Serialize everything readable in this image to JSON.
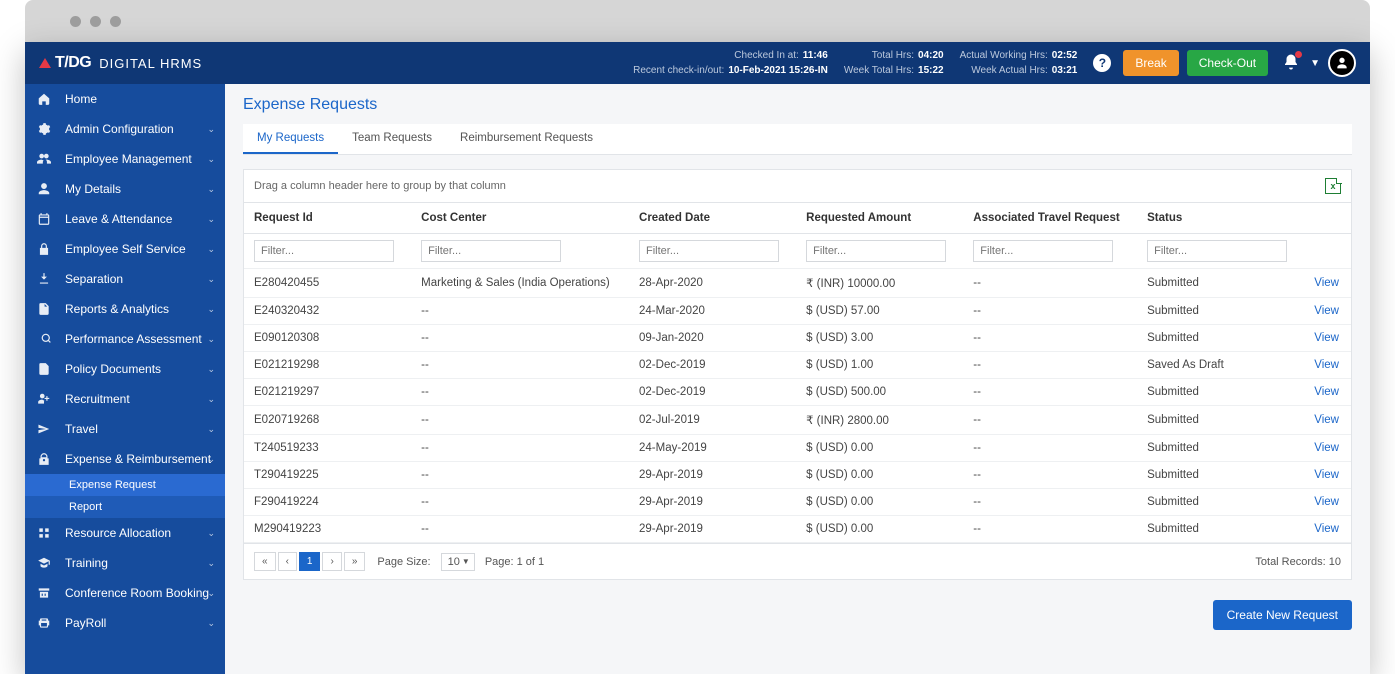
{
  "brand": {
    "tdg": "T/DG",
    "name": "DIGITAL HRMS"
  },
  "header": {
    "checked_in_label": "Checked In at:",
    "checked_in_value": "11:46",
    "recent_label": "Recent check-in/out:",
    "recent_value": "10-Feb-2021 15:26-IN",
    "total_hrs_label": "Total Hrs:",
    "total_hrs_value": "04:20",
    "week_total_label": "Week Total Hrs:",
    "week_total_value": "15:22",
    "actual_label": "Actual Working Hrs:",
    "actual_value": "02:52",
    "week_actual_label": "Week Actual Hrs:",
    "week_actual_value": "03:21",
    "break_btn": "Break",
    "checkout_btn": "Check-Out"
  },
  "sidebar": {
    "items": [
      {
        "label": "Home",
        "expandable": false
      },
      {
        "label": "Admin Configuration",
        "expandable": true
      },
      {
        "label": "Employee Management",
        "expandable": true
      },
      {
        "label": "My Details",
        "expandable": true
      },
      {
        "label": "Leave & Attendance",
        "expandable": true
      },
      {
        "label": "Employee Self Service",
        "expandable": true
      },
      {
        "label": "Separation",
        "expandable": true
      },
      {
        "label": "Reports & Analytics",
        "expandable": true
      },
      {
        "label": "Performance Assessment",
        "expandable": true
      },
      {
        "label": "Policy Documents",
        "expandable": true
      },
      {
        "label": "Recruitment",
        "expandable": true
      },
      {
        "label": "Travel",
        "expandable": true
      },
      {
        "label": "Expense & Reimbursement",
        "expandable": true
      },
      {
        "label": "Resource Allocation",
        "expandable": true
      },
      {
        "label": "Training",
        "expandable": true
      },
      {
        "label": "Conference Room Booking",
        "expandable": true
      },
      {
        "label": "PayRoll",
        "expandable": true
      }
    ],
    "sub_expense": [
      {
        "label": "Expense Request",
        "active": true
      },
      {
        "label": "Report",
        "active": false
      }
    ]
  },
  "page": {
    "title": "Expense Requests",
    "tabs": [
      "My Requests",
      "Team Requests",
      "Reimbursement Requests"
    ],
    "active_tab": 0,
    "group_hint": "Drag a column header here to group by that column",
    "columns": [
      "Request Id",
      "Cost Center",
      "Created Date",
      "Requested Amount",
      "Associated Travel Request",
      "Status",
      ""
    ],
    "filter_placeholder": "Filter...",
    "rows": [
      {
        "id": "E280420455",
        "cc": "Marketing & Sales (India Operations)",
        "date": "28-Apr-2020",
        "amt": "₹ (INR) 10000.00",
        "atr": "--",
        "status": "Submitted"
      },
      {
        "id": "E240320432",
        "cc": "--",
        "date": "24-Mar-2020",
        "amt": "$ (USD) 57.00",
        "atr": "--",
        "status": "Submitted"
      },
      {
        "id": "E090120308",
        "cc": "--",
        "date": "09-Jan-2020",
        "amt": "$ (USD) 3.00",
        "atr": "--",
        "status": "Submitted"
      },
      {
        "id": "E021219298",
        "cc": "--",
        "date": "02-Dec-2019",
        "amt": "$ (USD) 1.00",
        "atr": "--",
        "status": "Saved As Draft"
      },
      {
        "id": "E021219297",
        "cc": "--",
        "date": "02-Dec-2019",
        "amt": "$ (USD) 500.00",
        "atr": "--",
        "status": "Submitted"
      },
      {
        "id": "E020719268",
        "cc": "--",
        "date": "02-Jul-2019",
        "amt": "₹ (INR) 2800.00",
        "atr": "--",
        "status": "Submitted"
      },
      {
        "id": "T240519233",
        "cc": "--",
        "date": "24-May-2019",
        "amt": "$ (USD) 0.00",
        "atr": "--",
        "status": "Submitted"
      },
      {
        "id": "T290419225",
        "cc": "--",
        "date": "29-Apr-2019",
        "amt": "$ (USD) 0.00",
        "atr": "--",
        "status": "Submitted"
      },
      {
        "id": "F290419224",
        "cc": "--",
        "date": "29-Apr-2019",
        "amt": "$ (USD) 0.00",
        "atr": "--",
        "status": "Submitted"
      },
      {
        "id": "M290419223",
        "cc": "--",
        "date": "29-Apr-2019",
        "amt": "$ (USD) 0.00",
        "atr": "--",
        "status": "Submitted"
      }
    ],
    "view_label": "View",
    "pager": {
      "page_size_label": "Page Size:",
      "page_size_value": "10",
      "page_info": "Page: 1 of 1",
      "total_records": "Total Records: 10",
      "current": "1"
    },
    "create_btn": "Create New Request"
  }
}
